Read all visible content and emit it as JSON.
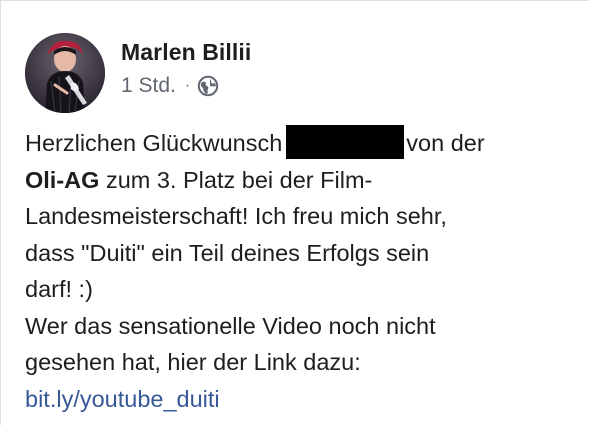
{
  "post": {
    "author": "Marlen Billii",
    "time": "1 Std.",
    "separator": "·",
    "visibility_icon": "globe-icon",
    "body": {
      "line1_before": "Herzlichen Glückwunsch",
      "line1_after": "von der",
      "org_name": "Oli-AG",
      "line2_rest": " zum 3. Platz bei der Film-",
      "line3": "Landesmeisterschaft! Ich freu mich sehr,",
      "line4": "dass \"Duiti\" ein Teil deines Erfolgs sein",
      "line5": "darf! :)",
      "line6": "Wer das sensationelle Video noch nicht",
      "line7": "gesehen hat, hier der Link dazu:",
      "link": "bit.ly/youtube_duiti"
    }
  },
  "colors": {
    "text": "#1c1e21",
    "secondary_text": "#606770",
    "link": "#385898",
    "redaction": "#000000"
  }
}
